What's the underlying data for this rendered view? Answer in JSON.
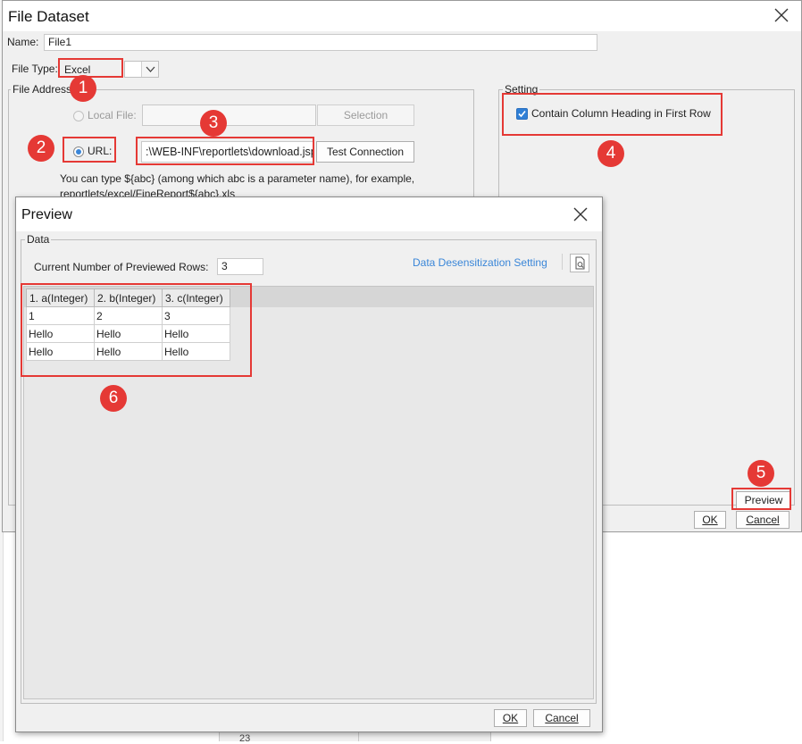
{
  "main_dialog": {
    "title": "File Dataset",
    "name_label": "Name:",
    "name_value": "File1",
    "file_type_label": "File Type:",
    "file_type_value": "Excel",
    "file_address_group": "File Address",
    "local_file_label": "Local File:",
    "local_file_value": "",
    "selection_button": "Selection",
    "url_label": "URL:",
    "url_value": ":\\WEB-INF\\reportlets\\download.jsp",
    "test_connection_button": "Test Connection",
    "hint_line1": "You can type ${abc} (among which abc is a parameter name), for example,",
    "hint_line2": "reportlets/excel/FineReport${abc}.xls",
    "setting_group": "Setting",
    "contain_heading_label": "Contain Column Heading in First Row",
    "contain_heading_checked": true,
    "preview_button": "Preview",
    "ok_button": "OK",
    "cancel_button": "Cancel"
  },
  "preview_dialog": {
    "title": "Preview",
    "data_group": "Data",
    "rows_label": "Current Number of Previewed Rows:",
    "rows_value": "3",
    "desensitization_link": "Data Desensitization Setting",
    "columns": [
      "1. a(Integer)",
      "2. b(Integer)",
      "3. c(Integer)"
    ],
    "rows": [
      [
        "1",
        "2",
        "3"
      ],
      [
        "Hello",
        "Hello",
        "Hello"
      ],
      [
        "Hello",
        "Hello",
        "Hello"
      ]
    ],
    "ok_button": "OK",
    "cancel_button": "Cancel"
  },
  "background": {
    "row_number": "23"
  },
  "annotations": [
    "1",
    "2",
    "3",
    "4",
    "5",
    "6"
  ],
  "icons": {
    "close": "close-icon",
    "dropdown": "chevron-down-icon",
    "preview_table": "search-document-icon",
    "check": "check-icon"
  },
  "colors": {
    "annotation_red": "#e53935",
    "link_blue": "#3a86d8",
    "checkbox_blue": "#2f7fd6"
  }
}
